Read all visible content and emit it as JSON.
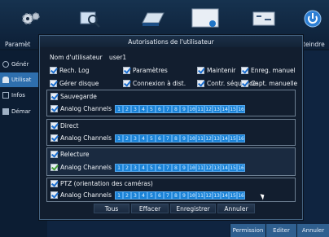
{
  "toolbar": {
    "param_label": "Paramèt",
    "shutdown_label": "teindre"
  },
  "sidebar": {
    "items": [
      {
        "label": "Génér"
      },
      {
        "label": "Utilisat"
      },
      {
        "label": "Infos"
      },
      {
        "label": "Démar"
      }
    ]
  },
  "bottom_tabs": {
    "permission": "Permission",
    "edit": "Editer",
    "cancel": "Annuler"
  },
  "dialog": {
    "title": "Autorisations de l'utilisateur",
    "username_label": "Nom d'utilisateur",
    "username_value": "user1",
    "permissions": [
      {
        "label": "Rech. Log"
      },
      {
        "label": "Paramètres"
      },
      {
        "label": "Maintenir"
      },
      {
        "label": "Enreg. manuel"
      },
      {
        "label": "Gérer disque"
      },
      {
        "label": "Connexion à dist."
      },
      {
        "label": "Contr. séquence"
      },
      {
        "label": "Capt. manuelle"
      }
    ],
    "groups": [
      {
        "title": "Sauvegarde",
        "channels_label": "Analog Channels"
      },
      {
        "title": "Direct",
        "channels_label": "Analog Channels"
      },
      {
        "title": "Relecture",
        "channels_label": "Analog Channels"
      },
      {
        "title": "PTZ (orientation des caméras)",
        "channels_label": "Analog Channels"
      }
    ],
    "channels": [
      "1",
      "2",
      "3",
      "4",
      "5",
      "6",
      "7",
      "8",
      "9",
      "10",
      "11",
      "12",
      "13",
      "14",
      "15",
      "16"
    ],
    "buttons": {
      "all": "Tous",
      "clear": "Effacer",
      "save": "Enregistrer",
      "cancel": "Annuler"
    }
  },
  "colors": {
    "accent": "#2e6fae",
    "channel": "#1a82d6",
    "check_blue": "#1c6fd0",
    "check_green": "#45a13a"
  }
}
